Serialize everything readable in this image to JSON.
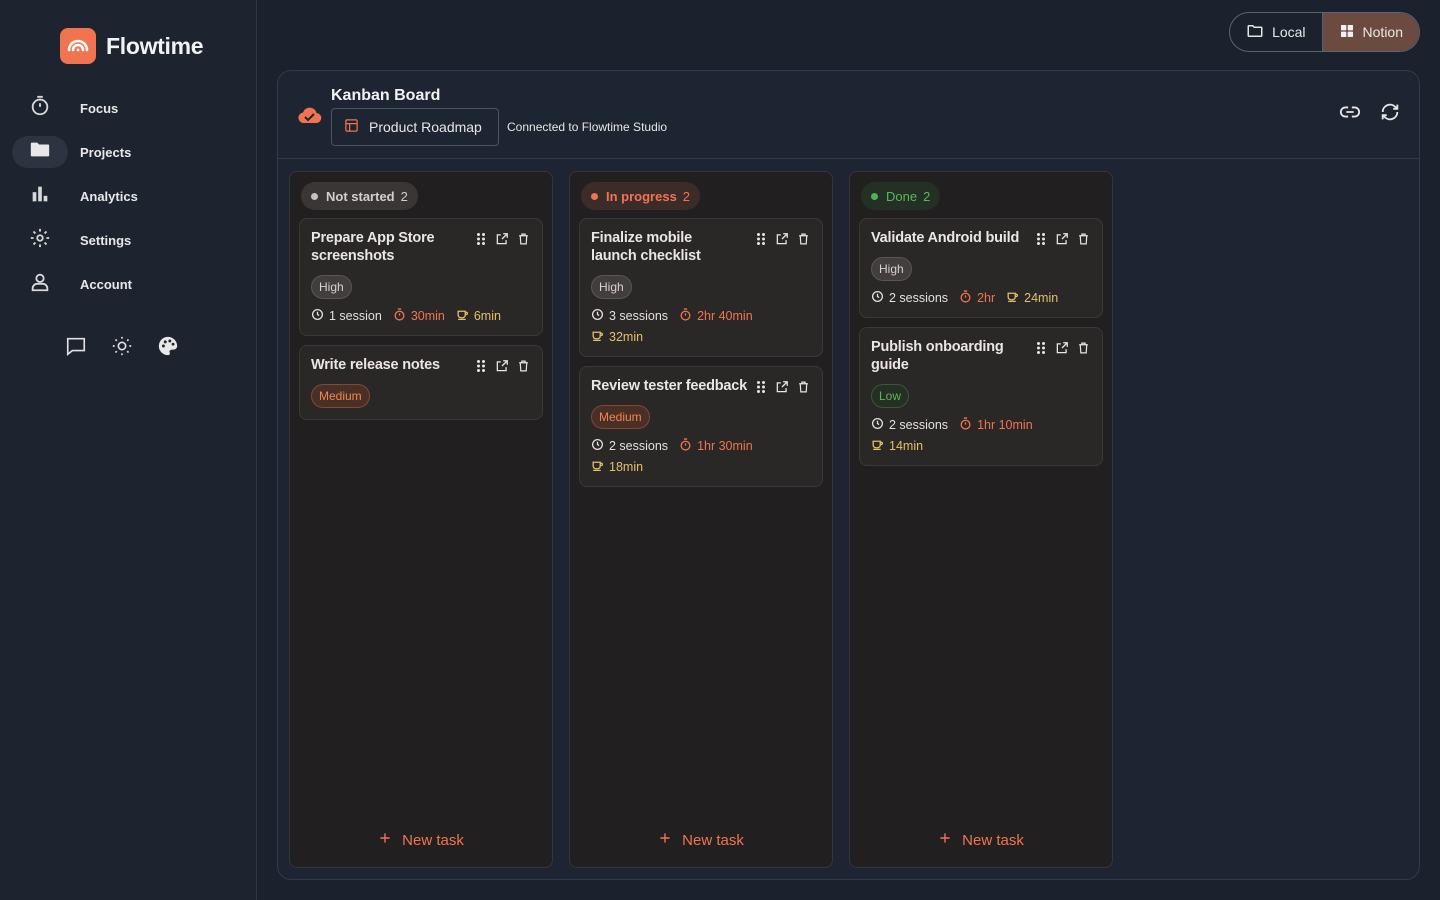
{
  "app": {
    "name": "Flowtime"
  },
  "sidebar": {
    "items": [
      {
        "label": "Focus",
        "icon": "timer-icon"
      },
      {
        "label": "Projects",
        "icon": "folder-icon",
        "active": true
      },
      {
        "label": "Analytics",
        "icon": "bar-chart-icon"
      },
      {
        "label": "Settings",
        "icon": "gear-icon"
      },
      {
        "label": "Account",
        "icon": "person-icon"
      }
    ]
  },
  "source_switch": {
    "local_label": "Local",
    "notion_label": "Notion",
    "selected": "Notion"
  },
  "board": {
    "title": "Kanban Board",
    "database": "Product Roadmap",
    "connection": "Connected to Flowtime Studio"
  },
  "columns": [
    {
      "status": "Not started",
      "count": "2",
      "new_task": "New task",
      "cards": [
        {
          "title": "Prepare App Store screenshots",
          "priority": "High",
          "sessions": "1 session",
          "time": "30min",
          "break": "6min"
        },
        {
          "title": "Write release notes",
          "priority": "Medium"
        }
      ]
    },
    {
      "status": "In progress",
      "count": "2",
      "new_task": "New task",
      "cards": [
        {
          "title": "Finalize mobile launch checklist",
          "priority": "High",
          "sessions": "3 sessions",
          "time": "2hr 40min",
          "break": "32min"
        },
        {
          "title": "Review tester feedback",
          "priority": "Medium",
          "sessions": "2 sessions",
          "time": "1hr 30min",
          "break": "18min"
        }
      ]
    },
    {
      "status": "Done",
      "count": "2",
      "new_task": "New task",
      "cards": [
        {
          "title": "Validate Android build",
          "priority": "High",
          "sessions": "2 sessions",
          "time": "2hr",
          "break": "24min"
        },
        {
          "title": "Publish onboarding guide",
          "priority": "Low",
          "sessions": "2 sessions",
          "time": "1hr 10min",
          "break": "14min"
        }
      ]
    }
  ],
  "colors": {
    "accent": "#f0744f",
    "done": "#4db454",
    "break": "#e2c06a"
  }
}
